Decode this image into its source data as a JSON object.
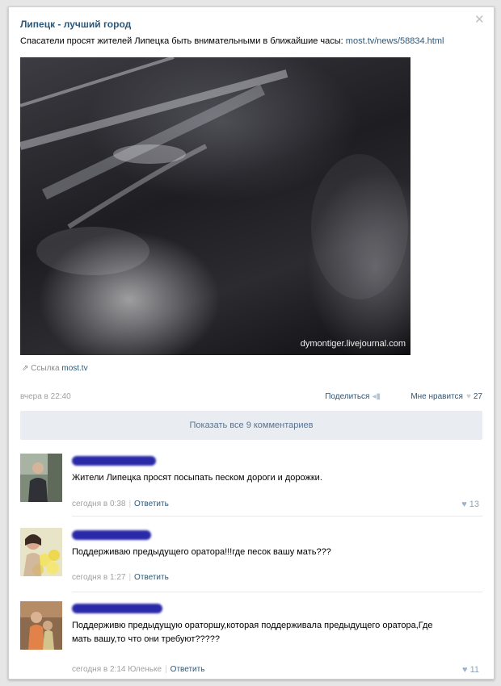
{
  "post": {
    "group_title": "Липецк - лучший город",
    "text": "Спасатели просят жителей Липецка быть внимательными в ближайшие часы:",
    "url": "most.tv/news/58834.html",
    "image_watermark": "dymontiger.livejournal.com",
    "link_label": "Ссылка",
    "link_domain": "most.tv",
    "time": "вчера в 22:40",
    "share_label": "Поделиться",
    "like_label": "Мне нравится",
    "like_count": "27",
    "show_all_comments": "Показать все 9 комментариев"
  },
  "icons": {
    "close": "close-icon",
    "link": "link-icon",
    "share": "megaphone-icon",
    "like": "heart-icon"
  },
  "colors": {
    "link": "#2b587a",
    "meta": "#a0a0a0",
    "show_all_bg": "#e9edf1"
  },
  "comments": [
    {
      "text": "Жители Липецка просят посыпать песком дороги и дорожки.",
      "time": "сегодня в 0:38",
      "reply_label": "Ответить",
      "likes": "13"
    },
    {
      "text": "Поддерживаю предыдущего оратора!!!где песок вашу мать???",
      "time": "сегодня в 1:27",
      "reply_label": "Ответить",
      "likes": ""
    },
    {
      "text_line1": "Поддерживю предыдущую ораторшу,которая поддерживала предыдущего оратора,Где",
      "text_line2": "мать вашу,то что они требуют?????",
      "time": "сегодня в 2:14",
      "addressee": "Юленьке",
      "reply_label": "Ответить",
      "likes": "11"
    }
  ]
}
